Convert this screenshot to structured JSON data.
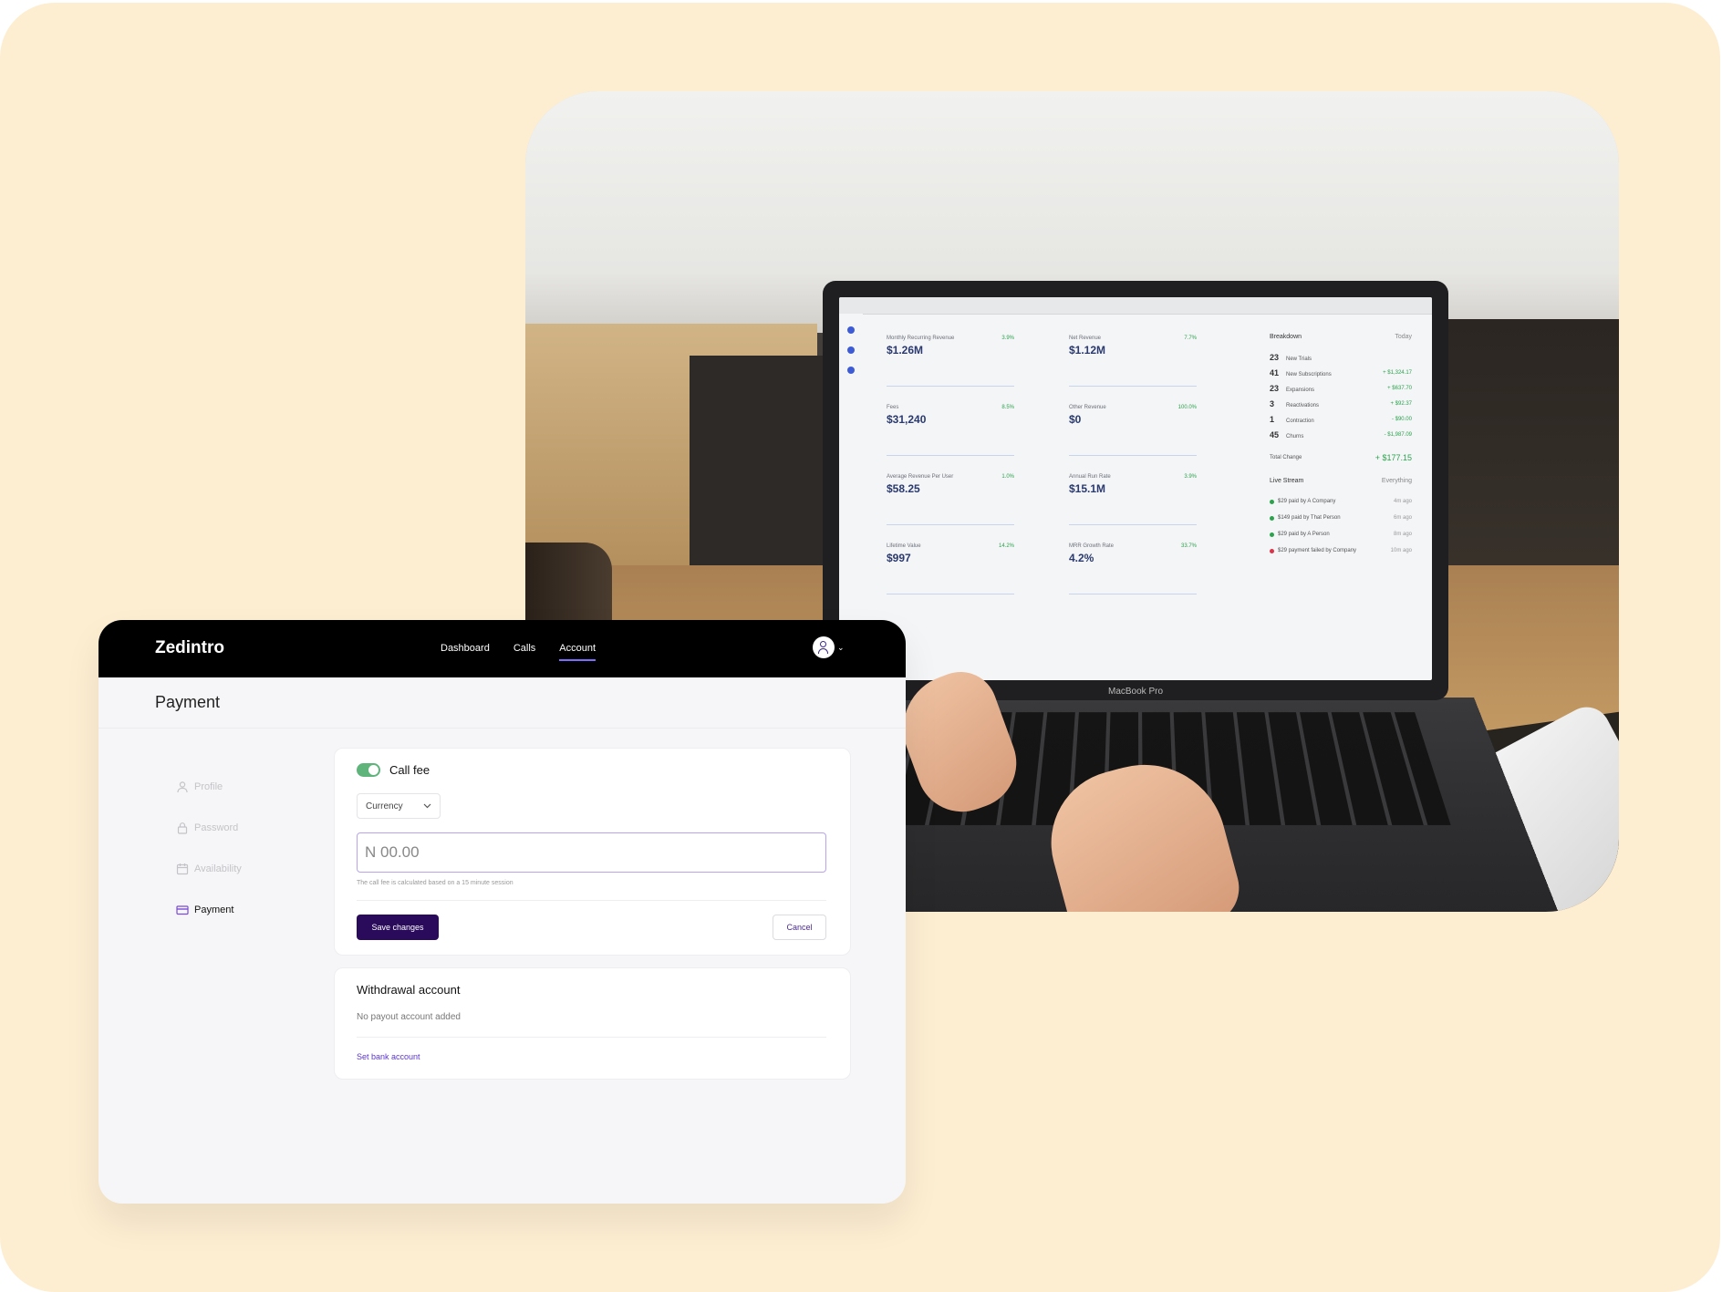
{
  "app": {
    "brand": "Zedintro",
    "nav": [
      {
        "label": "Dashboard",
        "active": false
      },
      {
        "label": "Calls",
        "active": false
      },
      {
        "label": "Account",
        "active": true
      }
    ],
    "page_title": "Payment",
    "sidebar": [
      {
        "label": "Profile",
        "icon": "user-icon",
        "active": false
      },
      {
        "label": "Password",
        "icon": "lock-icon",
        "active": false
      },
      {
        "label": "Availability",
        "icon": "calendar-icon",
        "active": false
      },
      {
        "label": "Payment",
        "icon": "credit-card-icon",
        "active": true
      }
    ],
    "call_fee": {
      "toggle_label": "Call fee",
      "toggle_on": true,
      "currency_label": "Currency",
      "amount_placeholder": "N 00.00",
      "amount_value": "",
      "hint": "The call fee is calculated based on a 15 minute session",
      "save_label": "Save changes",
      "cancel_label": "Cancel"
    },
    "withdrawal": {
      "title": "Withdrawal account",
      "status": "No payout account added",
      "link_label": "Set bank account"
    }
  },
  "laptop_screen": {
    "brand_label": "MacBook Pro",
    "metrics": [
      {
        "label": "Monthly Recurring Revenue",
        "value": "$1.26M",
        "change": "3.9%"
      },
      {
        "label": "Net Revenue",
        "value": "$1.12M",
        "change": "7.7%"
      },
      {
        "label": "Fees",
        "value": "$31,240",
        "change": "8.5%"
      },
      {
        "label": "Other Revenue",
        "value": "$0",
        "change": "100.0%"
      },
      {
        "label": "Average Revenue Per User",
        "value": "$58.25",
        "change": "1.0%"
      },
      {
        "label": "Annual Run Rate",
        "value": "$15.1M",
        "change": "3.9%"
      },
      {
        "label": "Lifetime Value",
        "value": "$997",
        "change": "14.2%"
      },
      {
        "label": "MRR Growth Rate",
        "value": "4.2%",
        "change": "33.7%"
      }
    ],
    "breakdown": {
      "title": "Breakdown",
      "period": "Today",
      "rows": [
        {
          "count": "23",
          "label": "New Trials",
          "amount": ""
        },
        {
          "count": "41",
          "label": "New Subscriptions",
          "amount": "+ $1,324.17"
        },
        {
          "count": "23",
          "label": "Expansions",
          "amount": "+ $637.70"
        },
        {
          "count": "3",
          "label": "Reactivations",
          "amount": "+ $92.37"
        },
        {
          "count": "1",
          "label": "Contraction",
          "amount": "- $90.00"
        },
        {
          "count": "45",
          "label": "Churns",
          "amount": "- $1,987.09"
        }
      ],
      "total_label": "Total Change",
      "total_value": "+ $177.15"
    },
    "live_stream": {
      "title": "Live Stream",
      "filter": "Everything",
      "items": [
        {
          "text": "$29 paid by A Company",
          "time": "4m ago"
        },
        {
          "text": "$149 paid by That Person",
          "time": "6m ago"
        },
        {
          "text": "$29 paid by A Person",
          "time": "8m ago"
        },
        {
          "text": "$29 payment failed by Company",
          "time": "10m ago"
        }
      ]
    }
  }
}
